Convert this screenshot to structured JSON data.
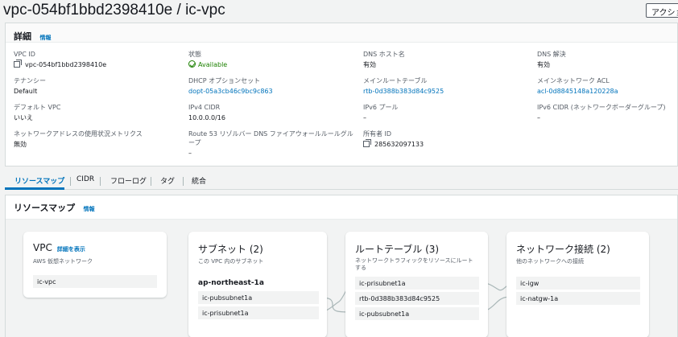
{
  "header": {
    "title": "vpc-054bf1bbd2398410e / ic-vpc",
    "action_label": "アクション"
  },
  "details": {
    "heading": "詳細",
    "info": "情報",
    "fields": [
      {
        "label": "VPC ID",
        "value": "vpc-054bf1bbd2398410e"
      },
      {
        "label": "状態",
        "value": "Available"
      },
      {
        "label": "DNS ホスト名",
        "value": "有効"
      },
      {
        "label": "DNS 解決",
        "value": "有効"
      },
      {
        "label": "テナンシー",
        "value": "Default"
      },
      {
        "label": "DHCP オプションセット",
        "value": "dopt-05a3cb46c9bc9c863"
      },
      {
        "label": "メインルートテーブル",
        "value": "rtb-0d388b383d84c9525"
      },
      {
        "label": "メインネットワーク ACL",
        "value": "acl-0d8845148a120228a"
      },
      {
        "label": "デフォルト VPC",
        "value": "いいえ"
      },
      {
        "label": "IPv4 CIDR",
        "value": "10.0.0.0/16"
      },
      {
        "label": "IPv6 プール",
        "value": "–"
      },
      {
        "label": "IPv6 CIDR (ネットワークボーダーグループ)",
        "value": "–"
      },
      {
        "label": "ネットワークアドレスの使用状況メトリクス",
        "value": "無効"
      },
      {
        "label": "Route 53 リゾルバー DNS ファイアウォールルールグループ",
        "value": "–"
      },
      {
        "label": "所有者 ID",
        "value": "285632097133"
      }
    ]
  },
  "tabs": [
    "リソースマップ",
    "CIDR",
    "フローログ",
    "タグ",
    "統合"
  ],
  "resource_map": {
    "heading": "リソースマップ",
    "info": "情報",
    "vpc": {
      "title": "VPC",
      "link": "詳細を表示",
      "subtitle": "AWS 仮想ネットワーク",
      "items": [
        "ic-vpc"
      ]
    },
    "subnets": {
      "title": "サブネット (2)",
      "subtitle": "この VPC 内のサブネット",
      "group": "ap-northeast-1a",
      "items": [
        "ic-pubsubnet1a",
        "ic-prisubnet1a"
      ]
    },
    "route_tables": {
      "title": "ルートテーブル (3)",
      "subtitle": "ネットワークトラフィックをリソースにルートする",
      "items": [
        "ic-prisubnet1a",
        "rtb-0d388b383d84c9525",
        "ic-pubsubnet1a"
      ]
    },
    "connections": {
      "title": "ネットワーク接続 (2)",
      "subtitle": "他のネットワークへの接続",
      "items": [
        "ic-igw",
        "ic-natgw-1a"
      ]
    }
  }
}
